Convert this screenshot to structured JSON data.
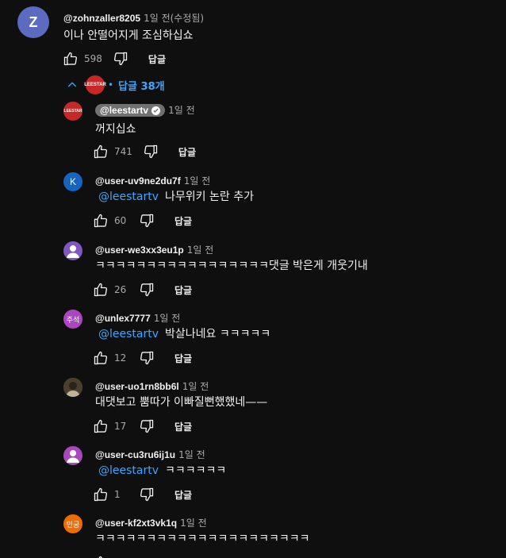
{
  "top_comment": {
    "avatar_letter": "Z",
    "author": "@zohnzaller8205",
    "time": "1일 전(수정됨)",
    "text": "이나 안떨어지게 조심하십쇼",
    "likes": "598",
    "reply_label": "답글"
  },
  "replies_toggle": {
    "channel_logo_text": "LEESTAR",
    "label": "답글 38개"
  },
  "replies": [
    {
      "avatar": "LEESTAR",
      "author": "@leestartv",
      "time": "1일 전",
      "owner": true,
      "mention": "",
      "text": "꺼지십쇼",
      "likes": "741",
      "reply_label": "답글",
      "avatar_color": "#c62828"
    },
    {
      "avatar": "K",
      "author": "@user-uv9ne2du7f",
      "time": "1일 전",
      "owner": false,
      "mention": "@leestartv",
      "text": "나무위키 논란 추가",
      "likes": "60",
      "reply_label": "답글",
      "avatar_color": "#1565c0"
    },
    {
      "avatar": "",
      "author": "@user-we3xx3eu1p",
      "time": "1일 전",
      "owner": false,
      "mention": "",
      "text": "ㅋㅋㅋㅋㅋㅋㅋㅋㅋㅋㅋㅋㅋㅋㅋㅋㅋ댓글 박은게 개웃기내",
      "likes": "26",
      "reply_label": "답글",
      "avatar_color": "#7e57c2"
    },
    {
      "avatar": "주석",
      "author": "@unlex7777",
      "time": "1일 전",
      "owner": false,
      "mention": "@leestartv",
      "text": "박살나네요 ㅋㅋㅋㅋㅋ",
      "likes": "12",
      "reply_label": "답글",
      "avatar_color": "#ab47bc"
    },
    {
      "avatar": "",
      "author": "@user-uo1rn8bb6l",
      "time": "1일 전",
      "owner": false,
      "mention": "",
      "text": "대댓보고 뿜따가 이빠질뻔했했네——",
      "likes": "17",
      "reply_label": "답글",
      "avatar_color": "#6d5a3a"
    },
    {
      "avatar": "",
      "author": "@user-cu3ru6ij1u",
      "time": "1일 전",
      "owner": false,
      "mention": "@leestartv",
      "text": "ㅋㅋㅋㅋㅋㅋ",
      "likes": "1",
      "reply_label": "답글",
      "avatar_color": "#ab47bc"
    },
    {
      "avatar": "민궁",
      "author": "@user-kf2xt3vk1q",
      "time": "1일 전",
      "owner": false,
      "mention": "",
      "text": "ㅋㅋㅋㅋㅋㅋㅋㅋㅋㅋㅋㅋㅋㅋㅋㅋㅋㅋㅋㅋㅋ",
      "likes": "",
      "reply_label": "",
      "avatar_color": "#ef6c00"
    }
  ]
}
